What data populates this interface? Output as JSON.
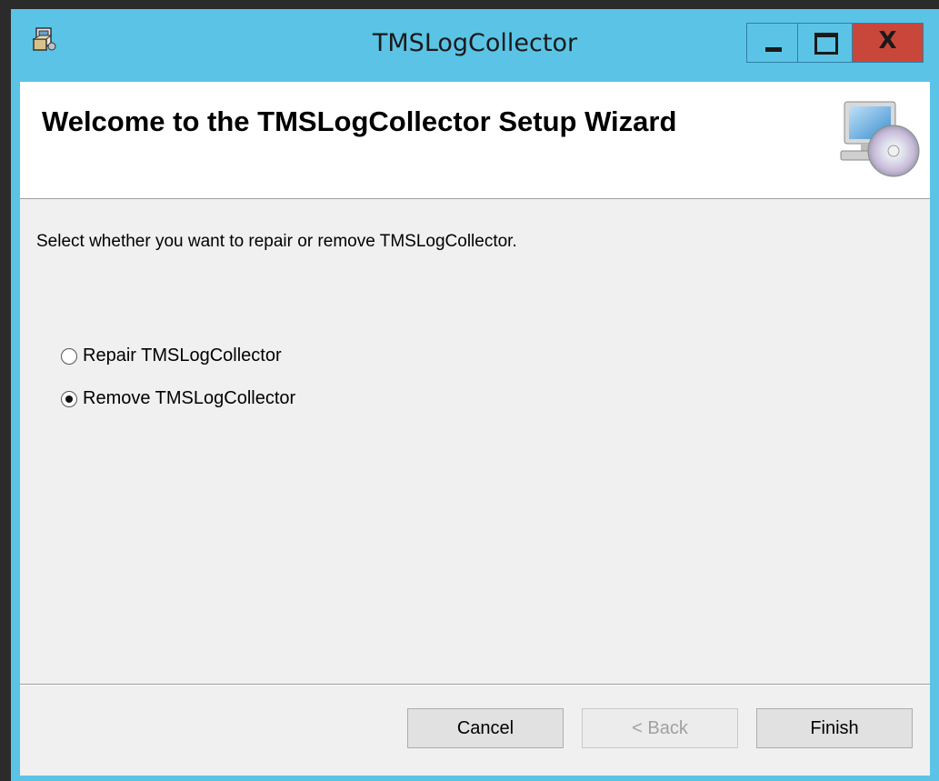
{
  "window": {
    "title": "TMSLogCollector",
    "controls": {
      "minimize": "minimize-icon",
      "maximize": "maximize-icon",
      "close": "close-icon",
      "close_glyph": "X"
    },
    "icon": "installer-icon"
  },
  "banner": {
    "title": "Welcome to the TMSLogCollector Setup Wizard",
    "icon": "computer-cd-icon"
  },
  "content": {
    "instruction": "Select whether you want to repair or remove TMSLogCollector.",
    "options": [
      {
        "label": "Repair TMSLogCollector",
        "selected": false
      },
      {
        "label": "Remove TMSLogCollector",
        "selected": true
      }
    ]
  },
  "buttons": {
    "cancel": "Cancel",
    "back": "< Back",
    "finish": "Finish"
  },
  "colors": {
    "frame": "#5bc4e6",
    "close_button": "#c9463a",
    "client_bg": "#f0f0f0"
  }
}
